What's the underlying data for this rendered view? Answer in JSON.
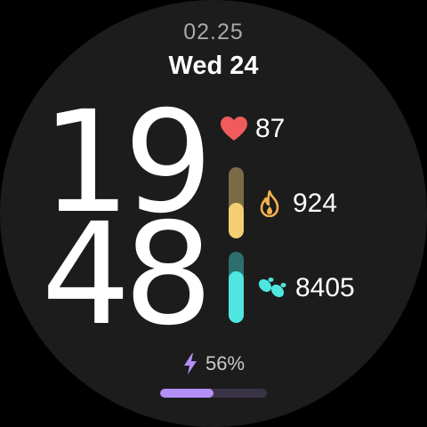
{
  "date": "02.25",
  "weekday": "Wed",
  "day_number": "24",
  "time": {
    "hours": "19",
    "minutes": "48"
  },
  "heart_rate": {
    "icon": "heart-icon",
    "value": "87",
    "color": "#f15b5b"
  },
  "calories": {
    "icon": "flame-icon",
    "value": "924",
    "progress": 0.5,
    "color": "#f3cf72",
    "track_color": "#7a6a46"
  },
  "steps": {
    "icon": "footsteps-icon",
    "value": "8405",
    "progress": 0.72,
    "color": "#4fe6e1",
    "track_color": "#2c6f6d"
  },
  "battery": {
    "icon": "lightning-icon",
    "label": "56%",
    "progress": 0.5,
    "color": "#b490f5",
    "track_color": "#3a3346"
  }
}
